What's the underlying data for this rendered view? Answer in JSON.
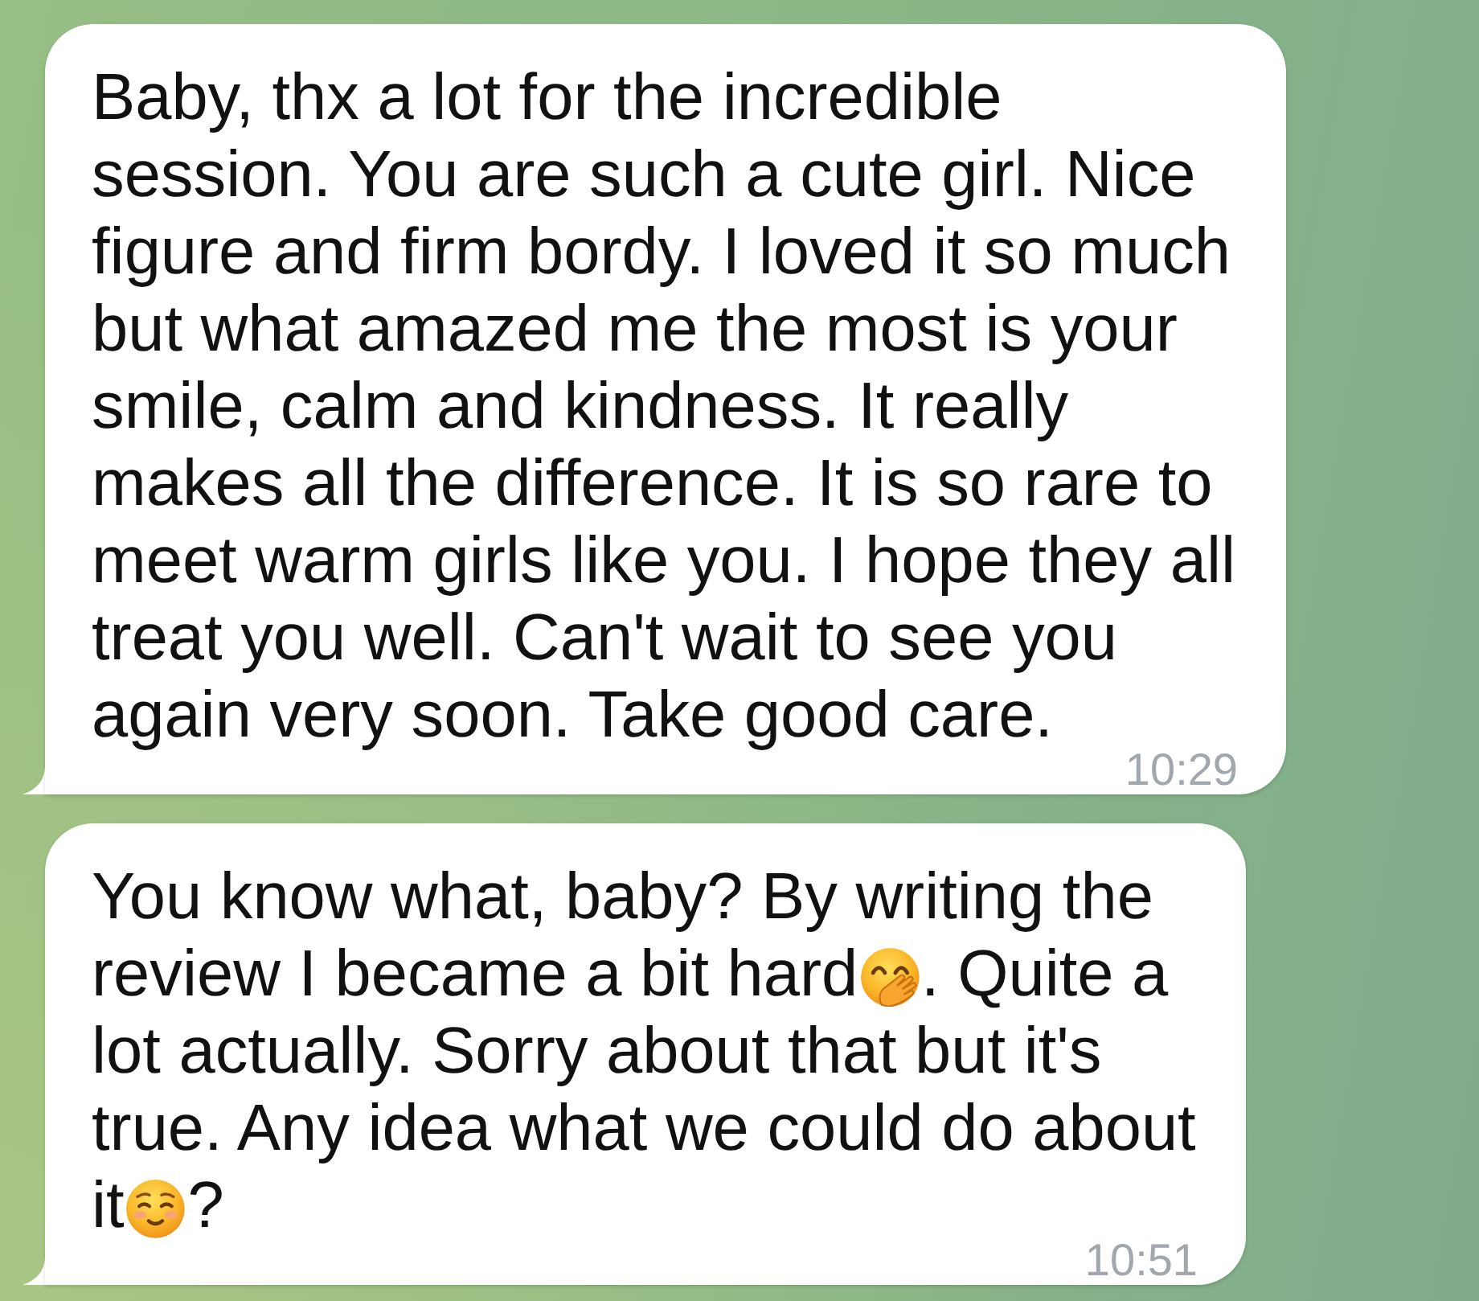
{
  "messages": [
    {
      "parts": [
        {
          "kind": "text",
          "text": "Baby, thx a lot for the incredible session. You are such a cute girl. Nice figure and firm bordy. I loved it so much but what amazed me the most is your smile, calm and kindness. It really makes all the difference. It is so rare to meet warm girls like you. I hope they all treat you well. Can't wait to see you again very soon. Take good care."
        }
      ],
      "time": "10:29",
      "tail": true
    },
    {
      "parts": [
        {
          "kind": "text",
          "text": "You know what, baby? By writing the review I became a bit hard"
        },
        {
          "kind": "giggle"
        },
        {
          "kind": "text",
          "text": ". Quite a lot actually. Sorry about that but it's true. Any idea what we could do about it"
        },
        {
          "kind": "smile"
        },
        {
          "kind": "text",
          "text": "?"
        }
      ],
      "time": "10:51",
      "tail": true
    }
  ]
}
